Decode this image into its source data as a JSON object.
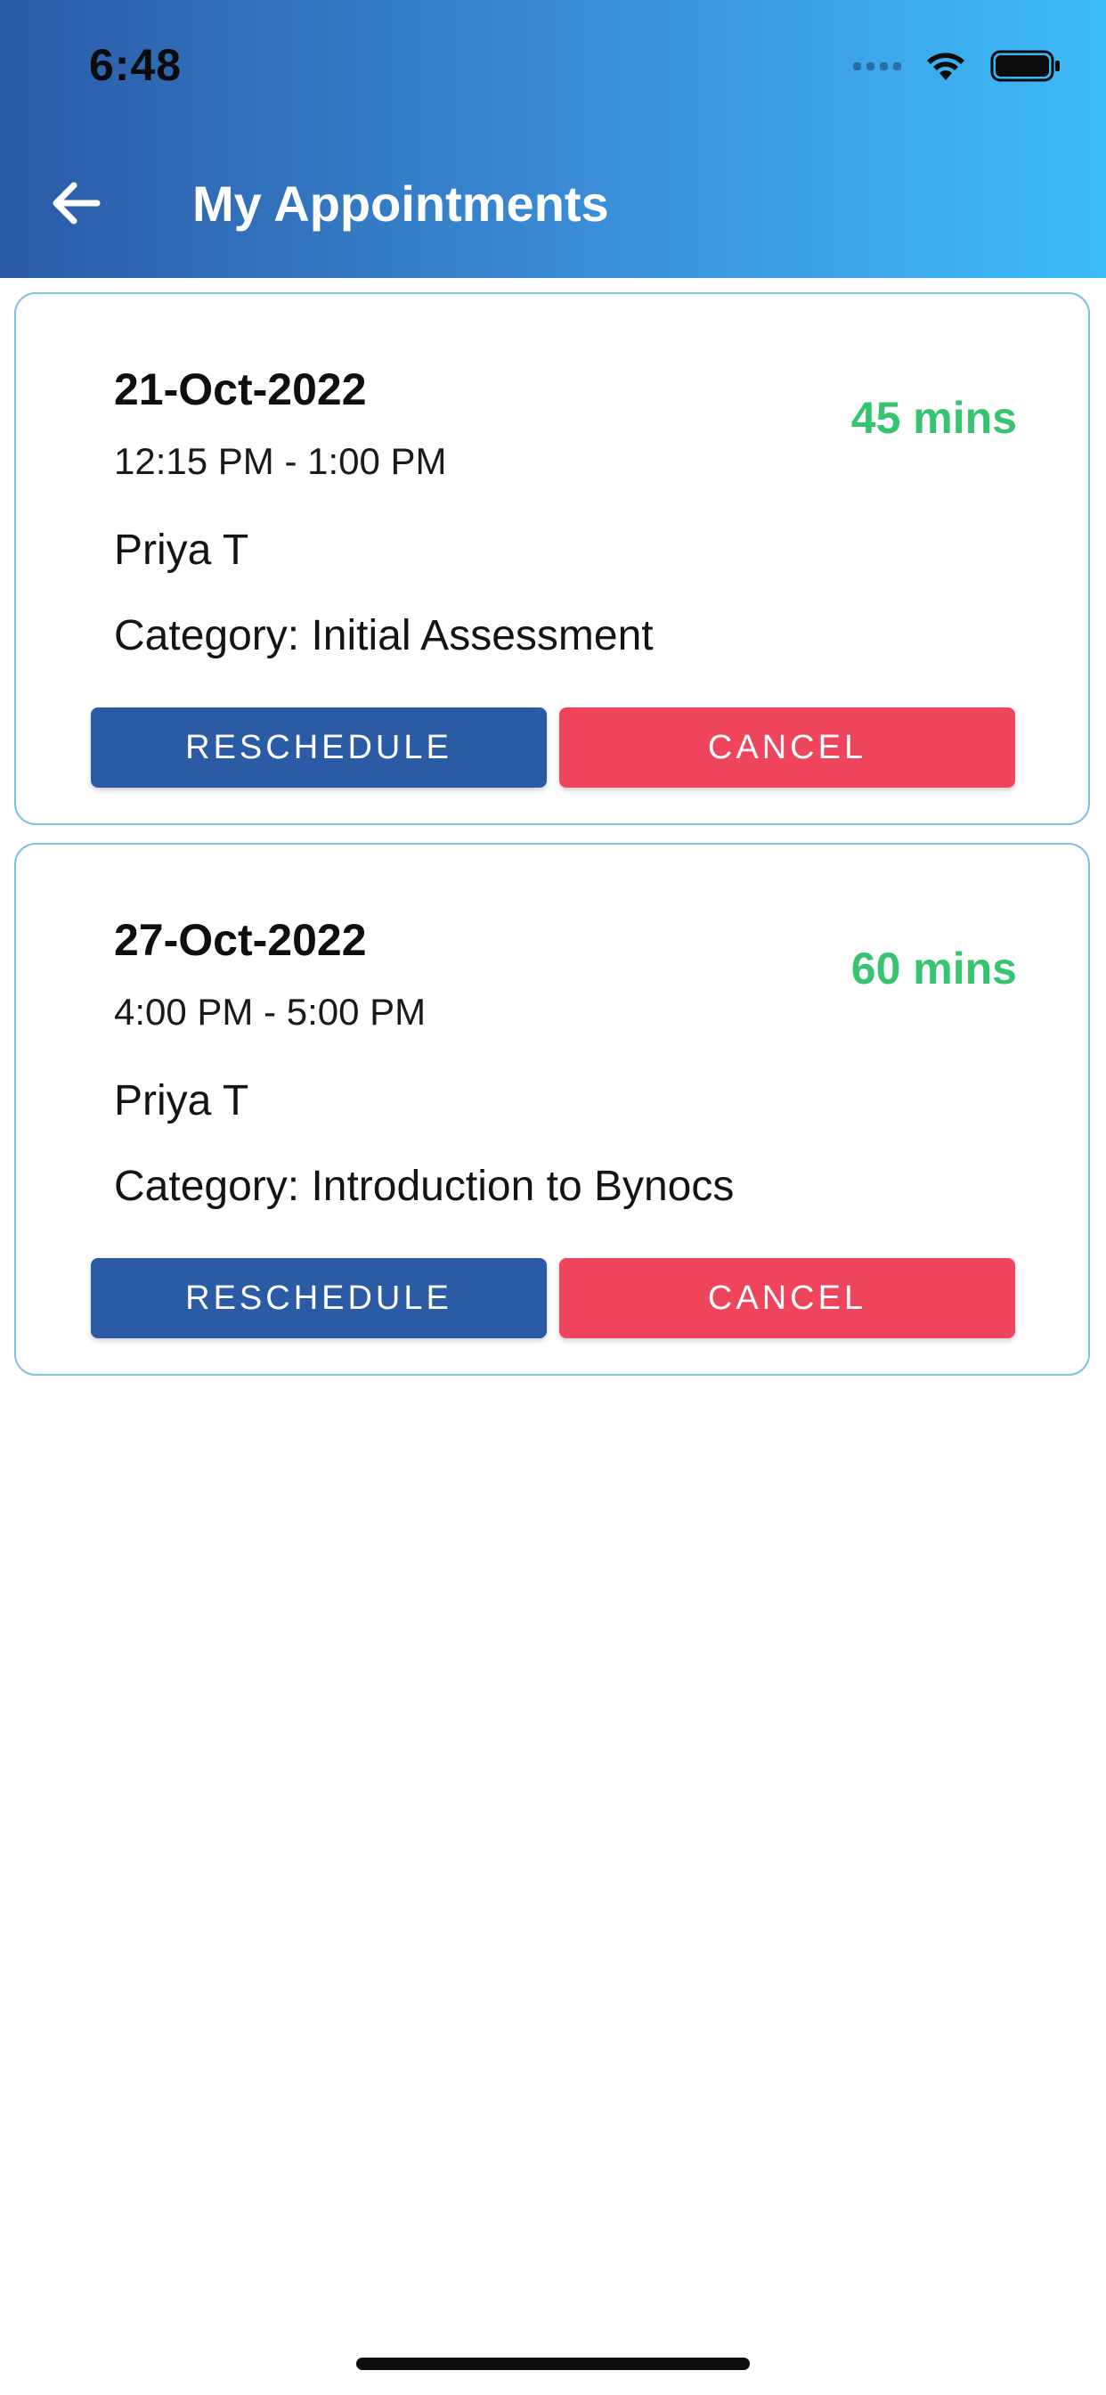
{
  "status_bar": {
    "time": "6:48"
  },
  "header": {
    "title": "My Appointments",
    "back_icon": "arrow-left-icon"
  },
  "colors": {
    "header_start": "#2b5aa6",
    "header_end": "#3dbcfb",
    "reschedule_button": "#2a5ba4",
    "cancel_button": "#ee445c",
    "duration_text": "#37c46e",
    "card_border": "#7cc2e3"
  },
  "appointments": [
    {
      "date": "21-Oct-2022",
      "time_range": "12:15 PM - 1:00 PM",
      "duration": "45 mins",
      "person": "Priya T",
      "category": "Category: Initial Assessment",
      "reschedule_label": "RESCHEDULE",
      "cancel_label": "CANCEL"
    },
    {
      "date": "27-Oct-2022",
      "time_range": "4:00 PM - 5:00 PM",
      "duration": "60 mins",
      "person": "Priya T",
      "category": "Category: Introduction to Bynocs",
      "reschedule_label": "RESCHEDULE",
      "cancel_label": "CANCEL"
    }
  ]
}
